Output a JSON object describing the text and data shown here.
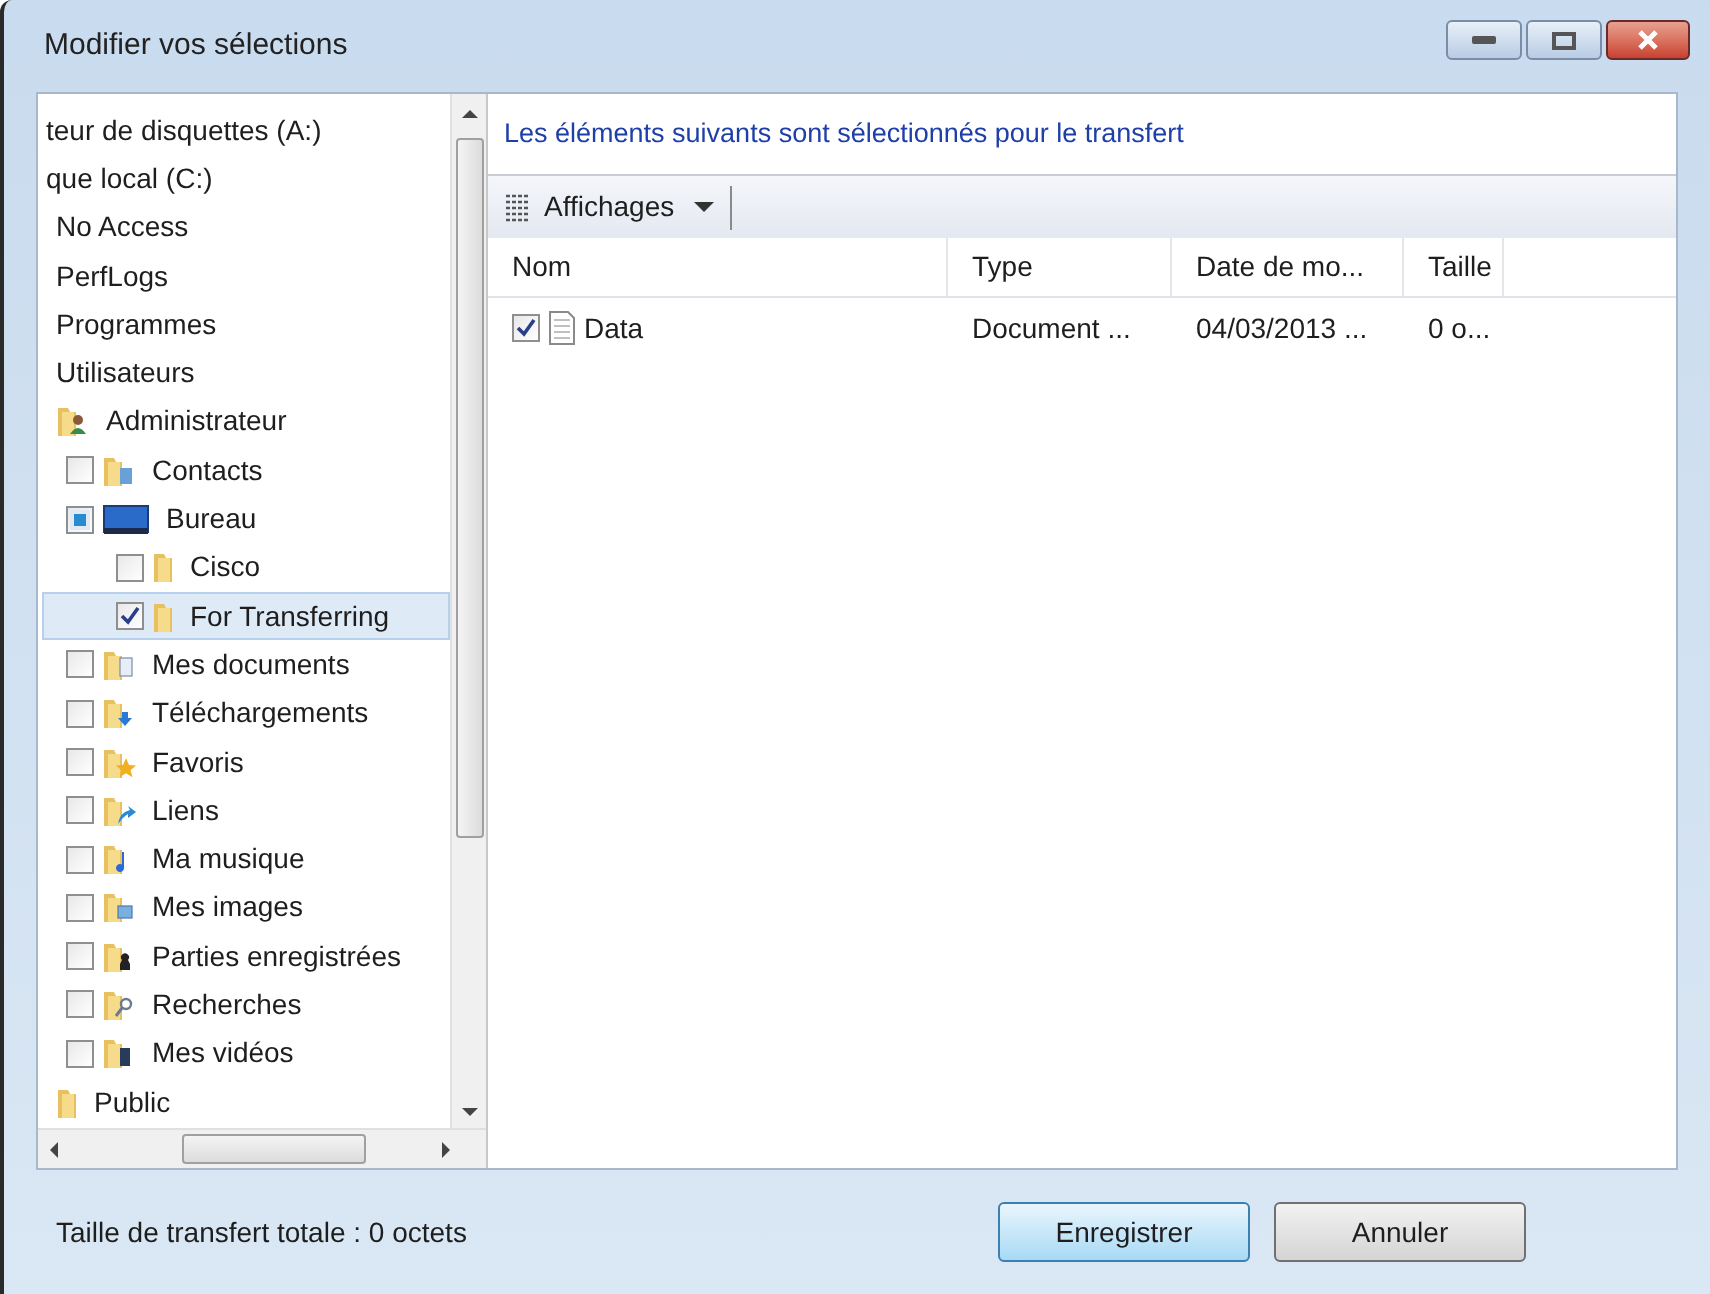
{
  "window": {
    "title": "Modifier vos sélections"
  },
  "tree": [
    {
      "label": "teur de disquettes (A:)",
      "kind": "plain",
      "selected": false
    },
    {
      "label": "que local (C:)",
      "kind": "plain",
      "selected": false,
      "children": [
        {
          "label": "No Access",
          "kind": "plain",
          "selected": false
        },
        {
          "label": "PerfLogs",
          "kind": "plain",
          "selected": false
        },
        {
          "label": "Programmes",
          "kind": "plain",
          "selected": false
        },
        {
          "label": "Utilisateurs",
          "kind": "plain",
          "selected": false,
          "children": [
            {
              "label": "Administrateur",
              "kind": "user",
              "selected": false,
              "children": [
                {
                  "label": "Contacts",
                  "kind": "contacts",
                  "checked": false,
                  "partial": false,
                  "selected": false
                },
                {
                  "label": "Bureau",
                  "kind": "desktop",
                  "checked": false,
                  "partial": true,
                  "selected": false,
                  "children": [
                    {
                      "label": "Cisco",
                      "kind": "folder",
                      "checked": false,
                      "partial": false,
                      "selected": false
                    },
                    {
                      "label": "For Transferring",
                      "kind": "folder",
                      "checked": true,
                      "partial": false,
                      "selected": true
                    }
                  ]
                },
                {
                  "label": "Mes documents",
                  "kind": "documents",
                  "checked": false,
                  "partial": false,
                  "selected": false
                },
                {
                  "label": "Téléchargements",
                  "kind": "downloads",
                  "checked": false,
                  "partial": false,
                  "selected": false
                },
                {
                  "label": "Favoris",
                  "kind": "favorites",
                  "checked": false,
                  "partial": false,
                  "selected": false
                },
                {
                  "label": "Liens",
                  "kind": "links",
                  "checked": false,
                  "partial": false,
                  "selected": false
                },
                {
                  "label": "Ma musique",
                  "kind": "music",
                  "checked": false,
                  "partial": false,
                  "selected": false
                },
                {
                  "label": "Mes images",
                  "kind": "pictures",
                  "checked": false,
                  "partial": false,
                  "selected": false
                },
                {
                  "label": "Parties enregistrées",
                  "kind": "games",
                  "checked": false,
                  "partial": false,
                  "selected": false
                },
                {
                  "label": "Recherches",
                  "kind": "searches",
                  "checked": false,
                  "partial": false,
                  "selected": false
                },
                {
                  "label": "Mes vidéos",
                  "kind": "videos",
                  "checked": false,
                  "partial": false,
                  "selected": false
                }
              ]
            },
            {
              "label": "Public",
              "kind": "folder",
              "selected": false
            }
          ]
        }
      ]
    }
  ],
  "heading": "Les éléments suivants sont sélectionnés pour le transfert",
  "toolbar": {
    "views_button": "Affichages"
  },
  "table": {
    "columns": [
      "Nom",
      "Type",
      "Date de mo...",
      "Taille"
    ],
    "rows": [
      {
        "checked": true,
        "cells": [
          "Data",
          "Document ...",
          "04/03/2013 ...",
          "0 o..."
        ]
      }
    ]
  },
  "status": "Taille de transfert totale : 0 octets",
  "buttons": [
    {
      "label": "Enregistrer",
      "kind": "primary"
    },
    {
      "label": "Annuler",
      "kind": "secondary"
    }
  ]
}
